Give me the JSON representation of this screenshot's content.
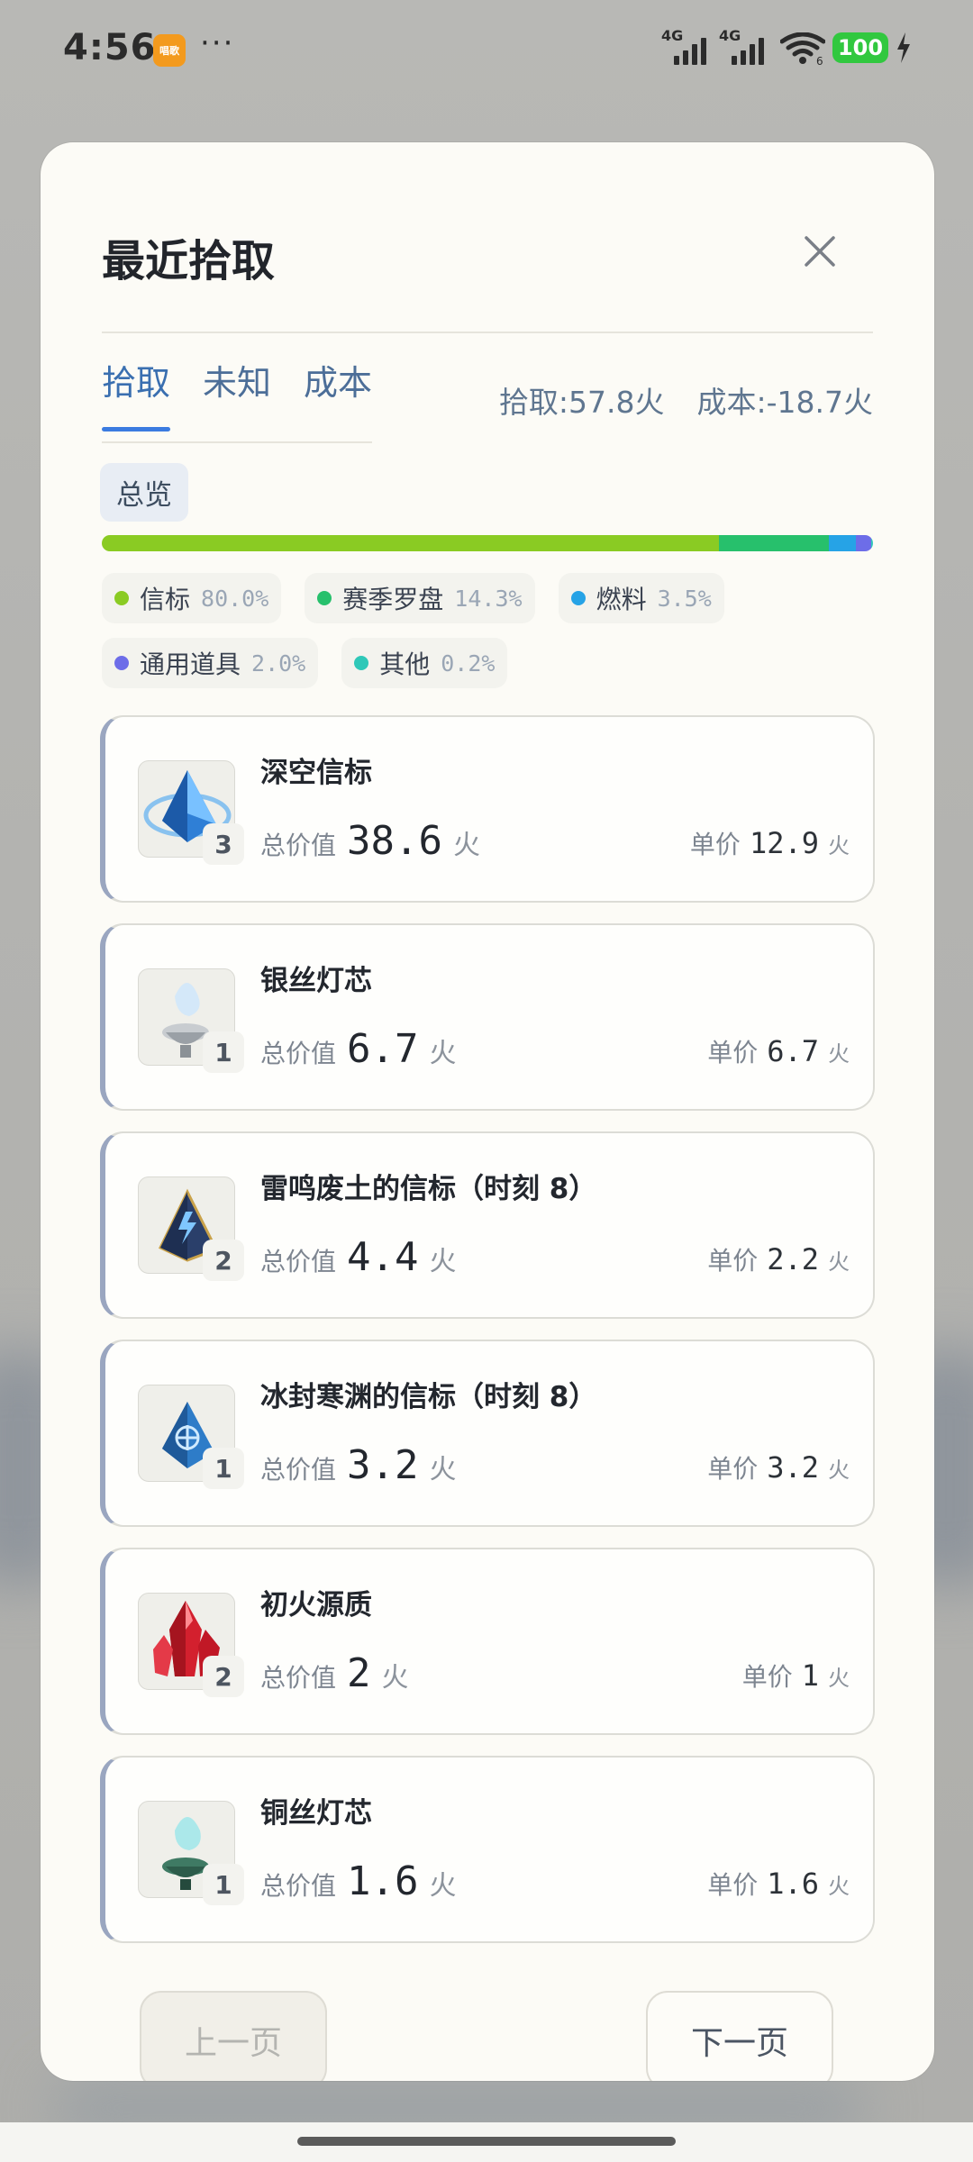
{
  "status_bar": {
    "time": "4:56",
    "app_badge": "唱歌",
    "more": "···",
    "signal_1": "4G",
    "signal_2": "4G",
    "wifi_sub": "6",
    "battery": "100"
  },
  "dialog": {
    "title": "最近拾取",
    "tabs": [
      {
        "label": "拾取",
        "active": true
      },
      {
        "label": "未知",
        "active": false
      },
      {
        "label": "成本",
        "active": false
      }
    ],
    "summary_pickup": "拾取:57.8火",
    "summary_cost": "成本:-18.7火",
    "overview_chip": "总览",
    "distribution": [
      {
        "name": "信标",
        "pct_label": "80.0%",
        "fraction": 0.8,
        "color": "#8acb23"
      },
      {
        "name": "赛季罗盘",
        "pct_label": "14.3%",
        "fraction": 0.143,
        "color": "#27c06c"
      },
      {
        "name": "燃料",
        "pct_label": "3.5%",
        "fraction": 0.035,
        "color": "#26a3e6"
      },
      {
        "name": "通用道具",
        "pct_label": "2.0%",
        "fraction": 0.02,
        "color": "#6d6de8"
      },
      {
        "name": "其他",
        "pct_label": "0.2%",
        "fraction": 0.002,
        "color": "#2fc8b8"
      }
    ],
    "total_label": "总价值",
    "unit_label": "单价",
    "currency": "火",
    "items": [
      {
        "name": "深空信标",
        "qty": "3",
        "total": "38.6",
        "unit": "12.9",
        "icon": "deep-space-beacon-icon"
      },
      {
        "name": "银丝灯芯",
        "qty": "1",
        "total": "6.7",
        "unit": "6.7",
        "icon": "silver-wick-icon"
      },
      {
        "name": "雷鸣废土的信标（时刻 8）",
        "qty": "2",
        "total": "4.4",
        "unit": "2.2",
        "icon": "thunder-wasteland-beacon-icon"
      },
      {
        "name": "冰封寒渊的信标（时刻 8）",
        "qty": "1",
        "total": "3.2",
        "unit": "3.2",
        "icon": "frozen-abyss-beacon-icon"
      },
      {
        "name": "初火源质",
        "qty": "2",
        "total": "2",
        "unit": "1",
        "icon": "primal-fire-crystal-icon"
      },
      {
        "name": "铜丝灯芯",
        "qty": "1",
        "total": "1.6",
        "unit": "1.6",
        "icon": "copper-wick-icon"
      }
    ],
    "pager": {
      "prev": "上一页",
      "next": "下一页"
    }
  }
}
